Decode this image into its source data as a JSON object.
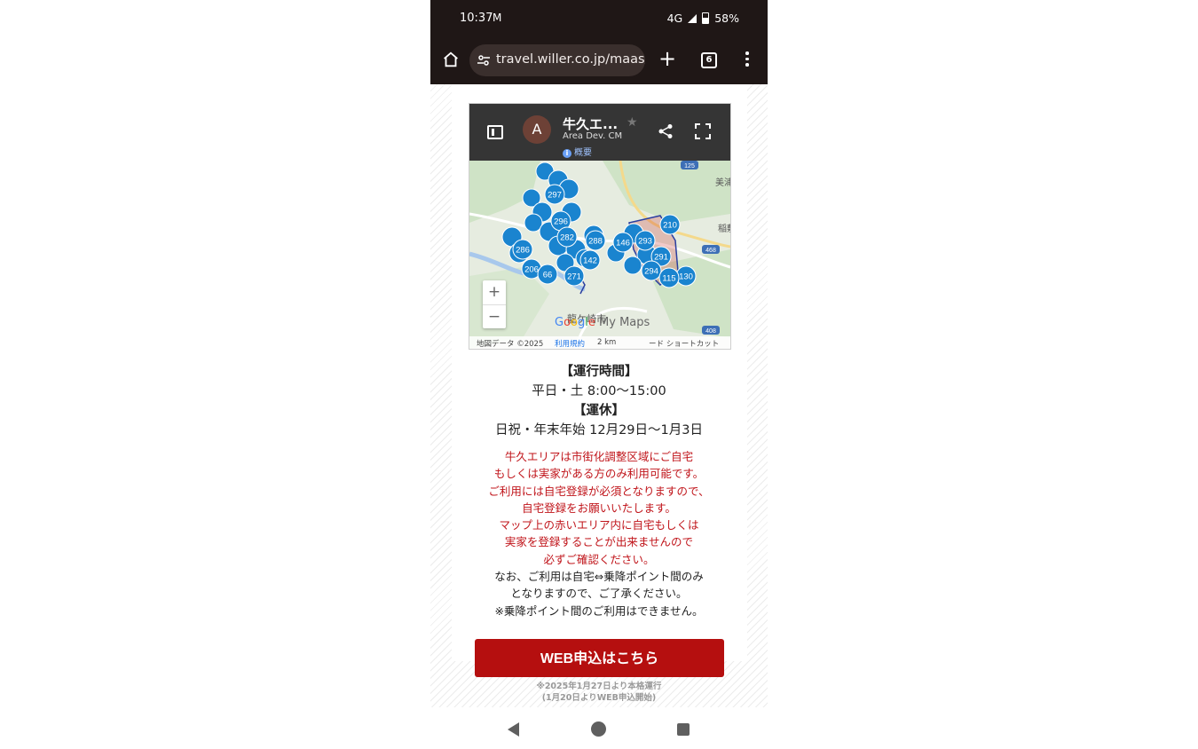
{
  "status": {
    "time": "10:37",
    "network": "4G",
    "battery": "58%",
    "icons": [
      "gmail-icon",
      "signal-icon",
      "battery-icon"
    ]
  },
  "browser": {
    "url": "travel.willer.co.jp/maas/n",
    "tab_count": "6",
    "icons": [
      "home-icon",
      "site-settings-icon",
      "new-tab-icon",
      "tab-switcher-icon",
      "menu-icon"
    ]
  },
  "map": {
    "title": "牛久エ...",
    "subtitle": "Area Dev. CM",
    "avatar_letter": "A",
    "overview_label": "概要",
    "zoom_in": "+",
    "zoom_out": "−",
    "logo": "Google My Maps",
    "attribution": "地図データ ©2025",
    "terms": "利用規約",
    "scale": "2 km",
    "shortcut": "ード ショートカット",
    "place_labels": [
      "美浦",
      "稲敷",
      "龍ケ崎市"
    ],
    "road_labels": [
      "125",
      "468",
      "408"
    ],
    "marker_labels": [
      "297",
      "296",
      "282",
      "288",
      "146",
      "293",
      "210",
      "286",
      "206",
      "291",
      "294",
      "130",
      "115",
      "142",
      "271",
      "66"
    ]
  },
  "schedule": {
    "hours_heading": "【運行時間】",
    "hours": "平日・土 8:00〜15:00",
    "holiday_heading": "【運休】",
    "holidays": "日祝・年末年始 12月29日〜1月3日"
  },
  "notice": {
    "red_lines": [
      "牛久エリアは市街化調整区域にご自宅",
      "もしくは実家がある方のみ利用可能です。",
      "ご利用には自宅登録が必須となりますので、",
      "自宅登録をお願いいたします。",
      "マップ上の赤いエリア内に自宅もしくは",
      "実家を登録することが出来ませんので",
      "必ずご確認ください。"
    ],
    "black_lines": [
      "なお、ご利用は自宅⇔乗降ポイント間のみ",
      "となりますので、ご了承ください。",
      "※乗降ポイント間のご利用はできません。"
    ]
  },
  "cta": {
    "label": "WEB申込はこちら",
    "footnote_1": "※2025年1月27日より本格運行",
    "footnote_2": "(1月20日よりWEB申込開始)"
  },
  "colors": {
    "cta": "#b50f0f",
    "notice_red": "#c0141a",
    "marker_blue": "#1a84cf",
    "chrome_dark": "#1f1716"
  }
}
